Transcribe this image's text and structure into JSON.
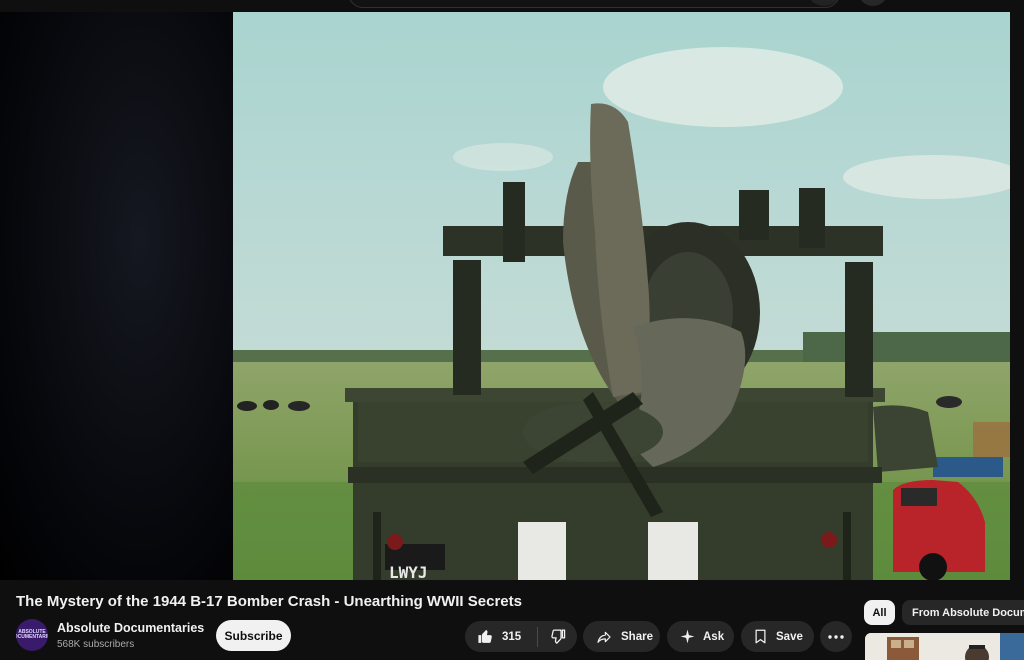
{
  "video": {
    "title": "The Mystery of the 1944 B-17 Bomber Crash - Unearthing WWII Secrets",
    "frame_plate_text": "LWYJ"
  },
  "channel": {
    "name": "Absolute Documentaries",
    "subscribers": "568K subscribers",
    "avatar_text": "ABSOLUTE DOCUMENTARIES"
  },
  "actions": {
    "subscribe_label": "Subscribe",
    "like_count": "315",
    "share_label": "Share",
    "ask_label": "Ask",
    "save_label": "Save"
  },
  "chips": {
    "all_label": "All",
    "from_label": "From Absolute Documentaries"
  },
  "icons": {
    "like": "thumbs-up-icon",
    "dislike": "thumbs-down-icon",
    "share": "share-arrow-icon",
    "ask": "sparkle-icon",
    "save": "bookmark-icon",
    "more": "more-horizontal-icon"
  },
  "colors": {
    "background": "#0f0f0f",
    "pill": "#272727",
    "subscribe_bg": "#f1f1f1",
    "text_primary": "#f1f1f1",
    "text_secondary": "#aaaaaa"
  }
}
